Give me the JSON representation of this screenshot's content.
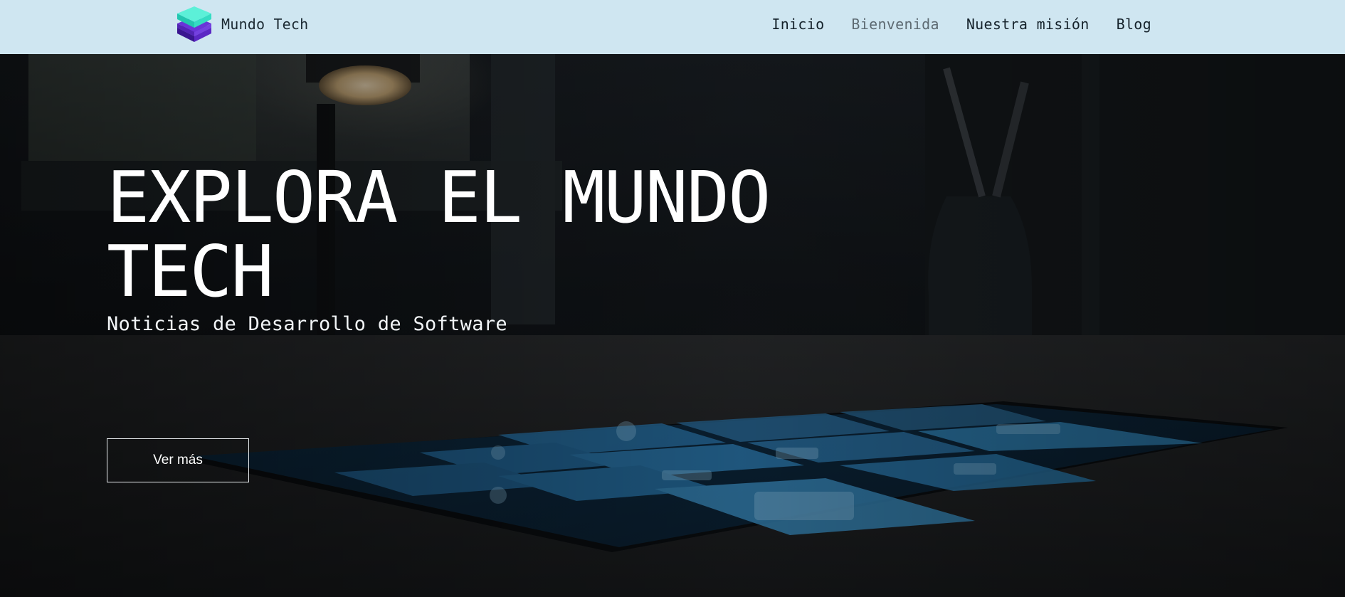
{
  "brand": {
    "name": "Mundo Tech",
    "logo_icon": "layered-cube-icon"
  },
  "nav": {
    "items": [
      {
        "label": "Inicio",
        "active": false
      },
      {
        "label": "Bienvenida",
        "active": true
      },
      {
        "label": "Nuestra misión",
        "active": false
      },
      {
        "label": "Blog",
        "active": false
      }
    ]
  },
  "hero": {
    "title": "EXPLORA EL MUNDO TECH",
    "subtitle": "Noticias de Desarrollo de Software",
    "button_label": "Ver más"
  },
  "colors": {
    "navbar_bg": "#cfe6f1",
    "logo_teal": "#2fe3c4",
    "logo_purple": "#6a2fd6",
    "hero_text": "#ffffff",
    "tile_blue": "#1f6fa0"
  }
}
